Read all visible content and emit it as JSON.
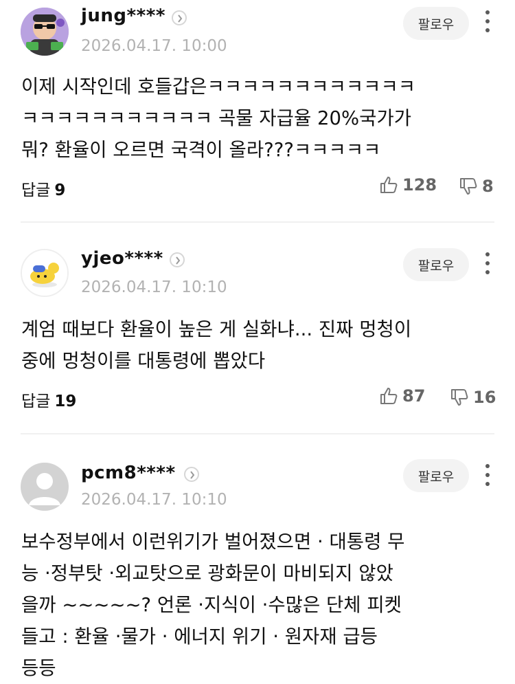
{
  "common": {
    "follow_label": "팔로우",
    "reply_prefix": "답글"
  },
  "comments": [
    {
      "username": "jung****",
      "date": "2026.04.17. 10:00",
      "lines": [
        "이제 시작인데 호들갑은ㅋㅋㅋㅋㅋㅋㅋㅋㅋㅋㅋㅋ",
        "ㅋㅋㅋㅋㅋㅋㅋㅋㅋㅋㅋ 곡물 자급율 20%국가가",
        "뭐? 환율이 오르면 국격이 올라???ㅋㅋㅋㅋㅋ"
      ],
      "replies": "9",
      "likes": "128",
      "dislikes": "8"
    },
    {
      "username": "yjeo****",
      "date": "2026.04.17. 10:10",
      "lines": [
        "계엄 때보다 환율이 높은 게 실화냐... 진짜 멍청이",
        "중에 멍청이를 대통령에 뽑았다"
      ],
      "replies": "19",
      "likes": "87",
      "dislikes": "16"
    },
    {
      "username": "pcm8****",
      "date": "2026.04.17. 10:10",
      "lines": [
        "보수정부에서 이런위기가 벌어졌으면 · 대통령 무",
        "능 ·정부탓 ·외교탓으로 광화문이 마비되지 않았",
        "을까 ~~~~~? 언론 ·지식이 ·수많은 단체 피켓",
        "들고 : 환율 ·물가 · 에너지 위기 · 원자재 급등",
        "등등"
      ]
    }
  ]
}
